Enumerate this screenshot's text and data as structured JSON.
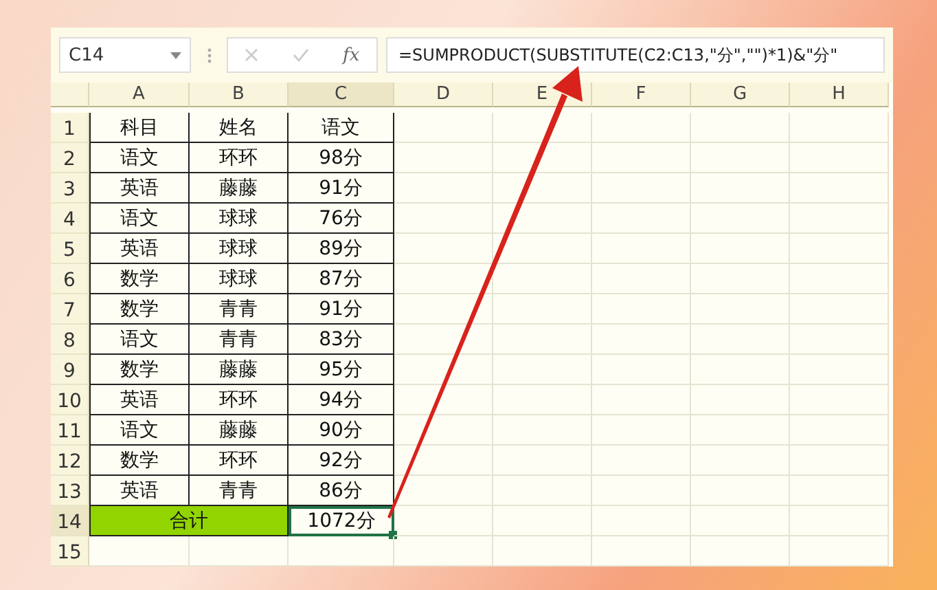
{
  "formula_bar": {
    "name_box": "C14",
    "fx_label": "fx",
    "formula": "=SUMPRODUCT(SUBSTITUTE(C2:C13,\"分\",\"\")*1)&\"分\""
  },
  "columns": [
    {
      "label": "A",
      "selected": false
    },
    {
      "label": "B",
      "selected": false
    },
    {
      "label": "C",
      "selected": true
    },
    {
      "label": "D",
      "selected": false
    },
    {
      "label": "E",
      "selected": false
    },
    {
      "label": "F",
      "selected": false
    },
    {
      "label": "G",
      "selected": false
    },
    {
      "label": "H",
      "selected": false
    }
  ],
  "rows": [
    {
      "number": "1",
      "kind": "data",
      "selected": false,
      "cells": [
        "科目",
        "姓名",
        "语文"
      ]
    },
    {
      "number": "2",
      "kind": "data",
      "selected": false,
      "cells": [
        "语文",
        "环环",
        "98分"
      ]
    },
    {
      "number": "3",
      "kind": "data",
      "selected": false,
      "cells": [
        "英语",
        "藤藤",
        "91分"
      ]
    },
    {
      "number": "4",
      "kind": "data",
      "selected": false,
      "cells": [
        "语文",
        "球球",
        "76分"
      ]
    },
    {
      "number": "5",
      "kind": "data",
      "selected": false,
      "cells": [
        "英语",
        "球球",
        "89分"
      ]
    },
    {
      "number": "6",
      "kind": "data",
      "selected": false,
      "cells": [
        "数学",
        "球球",
        "87分"
      ]
    },
    {
      "number": "7",
      "kind": "data",
      "selected": false,
      "cells": [
        "数学",
        "青青",
        "91分"
      ]
    },
    {
      "number": "8",
      "kind": "data",
      "selected": false,
      "cells": [
        "语文",
        "青青",
        "83分"
      ]
    },
    {
      "number": "9",
      "kind": "data",
      "selected": false,
      "cells": [
        "数学",
        "藤藤",
        "95分"
      ]
    },
    {
      "number": "10",
      "kind": "data",
      "selected": false,
      "cells": [
        "英语",
        "环环",
        "94分"
      ]
    },
    {
      "number": "11",
      "kind": "data",
      "selected": false,
      "cells": [
        "语文",
        "藤藤",
        "90分"
      ]
    },
    {
      "number": "12",
      "kind": "data",
      "selected": false,
      "cells": [
        "数学",
        "环环",
        "92分"
      ]
    },
    {
      "number": "13",
      "kind": "data",
      "selected": false,
      "cells": [
        "英语",
        "青青",
        "86分"
      ]
    },
    {
      "number": "14",
      "kind": "total",
      "selected": true,
      "label": "合计",
      "value": "1072分",
      "color": "#92d400"
    },
    {
      "number": "15",
      "kind": "empty",
      "selected": false
    }
  ]
}
